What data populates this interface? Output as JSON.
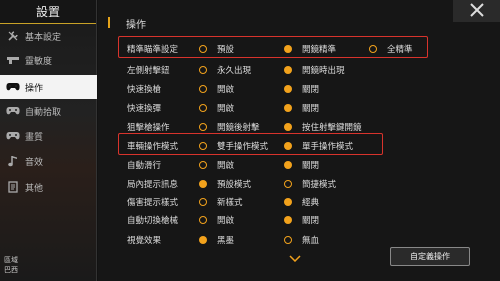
{
  "sidebar": {
    "title": "設置",
    "items": [
      {
        "label": "基本設定",
        "icon": "wrench-icon",
        "active": false
      },
      {
        "label": "靈敏度",
        "icon": "gun-icon",
        "active": false
      },
      {
        "label": "操作",
        "icon": "gamepad-icon",
        "active": true
      },
      {
        "label": "自動拾取",
        "icon": "gamepad-icon",
        "active": false
      },
      {
        "label": "畫質",
        "icon": "gamepad-icon",
        "active": false
      },
      {
        "label": "音效",
        "icon": "music-note-icon",
        "active": false
      },
      {
        "label": "其他",
        "icon": "document-icon",
        "active": false
      }
    ],
    "region_label": "區域",
    "region_value": "巴西"
  },
  "main": {
    "header": "操作",
    "rows": [
      {
        "label": "精準瞄準設定",
        "options": [
          "預設",
          "開鏡精準",
          "全精準"
        ],
        "selected": 1,
        "highlighted": true
      },
      {
        "label": "左側射擊鈕",
        "options": [
          "永久出現",
          "開鏡時出現"
        ],
        "selected": 1
      },
      {
        "label": "快速換槍",
        "options": [
          "開啟",
          "關閉"
        ],
        "selected": 1
      },
      {
        "label": "快速換彈",
        "options": [
          "開啟",
          "關閉"
        ],
        "selected": 1
      },
      {
        "label": "狙擊槍操作",
        "options": [
          "開鏡後射擊",
          "按住射擊鍵開鏡"
        ],
        "selected": 1
      },
      {
        "label": "車輛操作模式",
        "options": [
          "雙手操作模式",
          "單手操作模式"
        ],
        "selected": 1,
        "highlighted": true
      },
      {
        "label": "自動滑行",
        "options": [
          "開啟",
          "關閉"
        ],
        "selected": 1
      },
      {
        "label": "局內提示訊息",
        "options": [
          "預設模式",
          "簡捷模式"
        ],
        "selected": 0
      },
      {
        "label": "傷害提示樣式",
        "options": [
          "新樣式",
          "經典"
        ],
        "selected": 1
      },
      {
        "label": "自動切換槍械",
        "options": [
          "開啟",
          "關閉"
        ],
        "selected": 1
      },
      {
        "label": "視覺效果",
        "options": [
          "黑墨",
          "無血"
        ],
        "selected": 0
      }
    ],
    "custom_button": "自定義操作"
  },
  "colors": {
    "accent": "#f2a21c",
    "highlight": "#d8332c"
  }
}
